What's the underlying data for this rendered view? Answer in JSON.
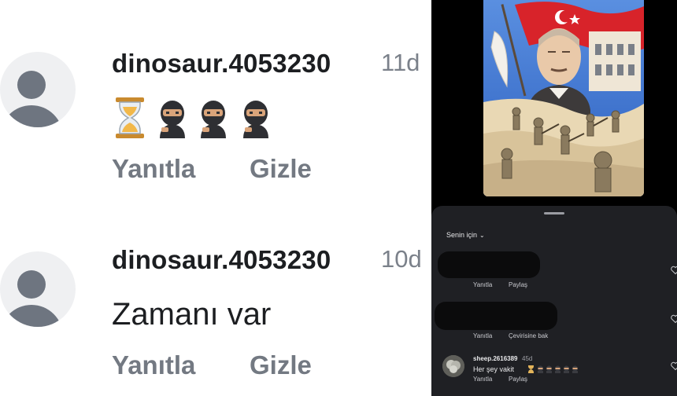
{
  "left_comments": [
    {
      "username": "dinosaur.4053230",
      "time": "11d",
      "text": "",
      "emojis": [
        "hourglass-emoji",
        "ninja-emoji",
        "ninja-emoji",
        "ninja-emoji"
      ],
      "actions": {
        "reply": "Yanıtla",
        "hide": "Gizle"
      }
    },
    {
      "username": "dinosaur.4053230",
      "time": "10d",
      "text": "Zamanı var",
      "actions": {
        "reply": "Yanıtla",
        "hide": "Gizle"
      }
    }
  ],
  "right_panel": {
    "filter_label": "Senin için",
    "comments": [
      {
        "actions": [
          "Yanıtla",
          "Paylaş"
        ]
      },
      {
        "actions": [
          "Yanıtla",
          "Çevirisine bak"
        ]
      },
      {
        "username": "sheep.2616389",
        "time": "45d",
        "text": "Her şey vakit",
        "actions": [
          "Yanıtla",
          "Paylaş"
        ]
      }
    ]
  },
  "colors": {
    "left_bg": "#ffffff",
    "username": "#1c1e21",
    "muted": "#737982",
    "avatar_bg": "#eff0f2",
    "avatar_fg": "#6e7580",
    "dark_sheet": "#1f2024",
    "artwork_sky": "#2f6fd6",
    "flag_red": "#d8232a"
  }
}
